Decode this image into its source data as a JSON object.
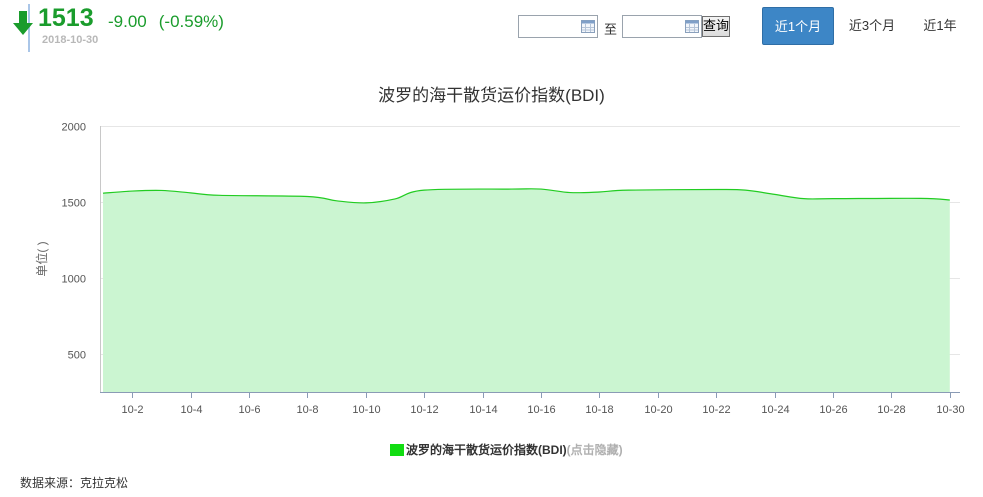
{
  "quote": {
    "price": "1513",
    "change": "-9.00",
    "change_pct": "(-0.59%)",
    "date": "2018-10-30",
    "direction_icon": "arrow-down-icon",
    "color": "#1a9c2c"
  },
  "range": {
    "start_value": "",
    "end_value": "",
    "separator": "至",
    "query_label": "查询",
    "calendar_icon": "calendar-icon"
  },
  "periods": [
    {
      "label": "近1个月",
      "active": true
    },
    {
      "label": "近3个月",
      "active": false
    },
    {
      "label": "近1年",
      "active": false
    }
  ],
  "legend": {
    "series_label": "波罗的海干散货运价指数(BDI)",
    "hint": "(点击隐藏)"
  },
  "source_text": "数据来源：克拉克松",
  "colors": {
    "line": "#22cc22",
    "area": "#cbf5d1",
    "active_button": "#3d86c6"
  },
  "chart_data": {
    "type": "area",
    "title": "波罗的海干散货运价指数(BDI)",
    "xlabel": "",
    "ylabel": "单位( )",
    "ylim": [
      250,
      2000
    ],
    "yticks": [
      500,
      1000,
      1500,
      2000
    ],
    "grid": true,
    "legend_position": "bottom",
    "x_tick_labels": [
      "10-2",
      "10-4",
      "10-6",
      "10-8",
      "10-10",
      "10-12",
      "10-14",
      "10-16",
      "10-18",
      "10-20",
      "10-22",
      "10-24",
      "10-26",
      "10-28",
      "10-30"
    ],
    "series": [
      {
        "name": "波罗的海干散货运价指数(BDI)",
        "points": [
          {
            "x": "10-1",
            "y": 1558
          },
          {
            "x": "10-2",
            "y": 1572
          },
          {
            "x": "10-3",
            "y": 1576
          },
          {
            "x": "10-4",
            "y": 1560
          },
          {
            "x": "10-5",
            "y": 1544
          },
          {
            "x": "10-8",
            "y": 1536
          },
          {
            "x": "10-9",
            "y": 1508
          },
          {
            "x": "10-10",
            "y": 1494
          },
          {
            "x": "10-11",
            "y": 1520
          },
          {
            "x": "10-12",
            "y": 1578
          },
          {
            "x": "10-15",
            "y": 1585
          },
          {
            "x": "10-16",
            "y": 1585
          },
          {
            "x": "10-17",
            "y": 1562
          },
          {
            "x": "10-18",
            "y": 1566
          },
          {
            "x": "10-19",
            "y": 1578
          },
          {
            "x": "10-22",
            "y": 1582
          },
          {
            "x": "10-23",
            "y": 1578
          },
          {
            "x": "10-24",
            "y": 1550
          },
          {
            "x": "10-25",
            "y": 1522
          },
          {
            "x": "10-26",
            "y": 1522
          },
          {
            "x": "10-29",
            "y": 1524
          },
          {
            "x": "10-30",
            "y": 1513
          }
        ]
      }
    ]
  }
}
